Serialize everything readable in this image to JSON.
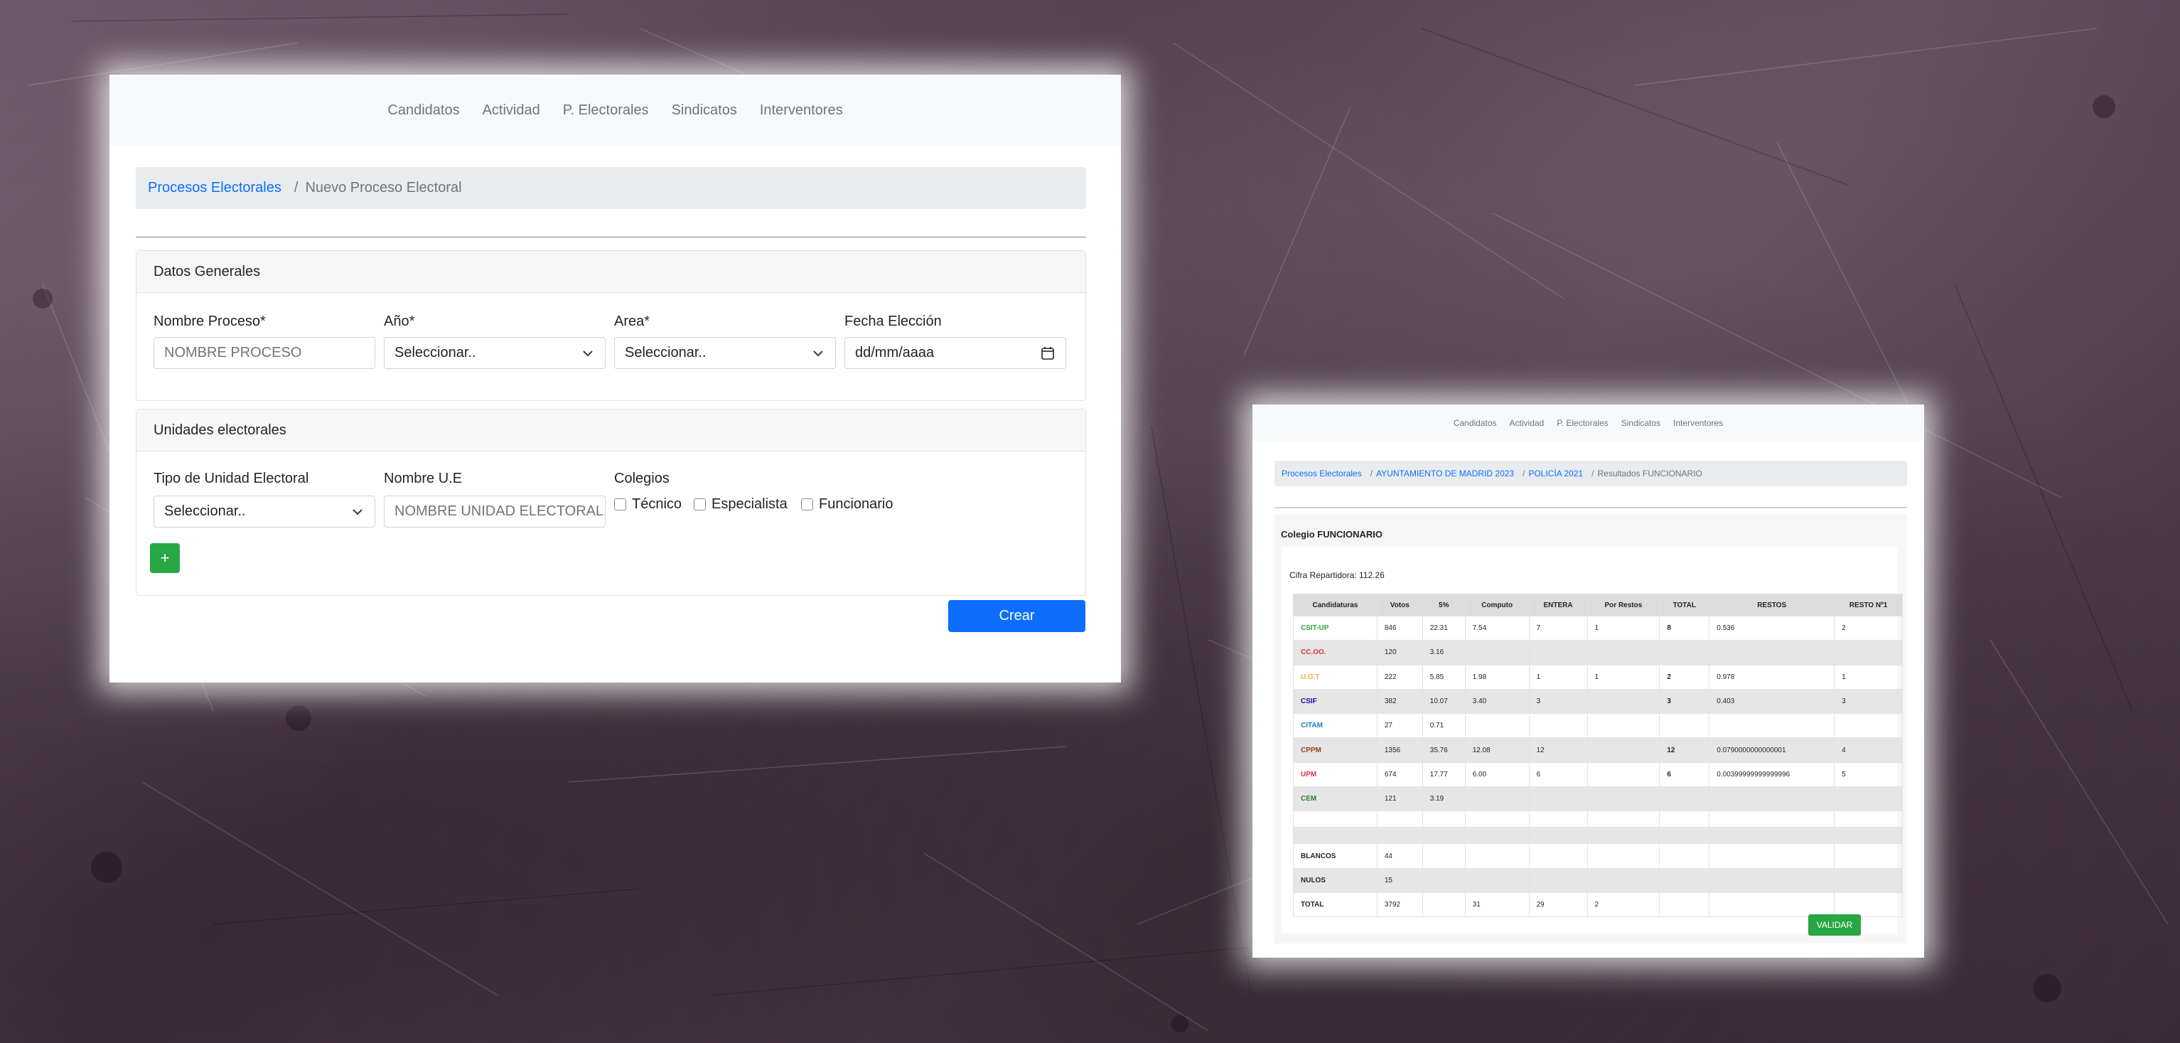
{
  "colors": {
    "primary": "#0d6efd",
    "success": "#28a745",
    "danger": "#dc3545",
    "party_colors": {
      "CSIT-UP": "#28a745",
      "CC.OO.": "#dc3545",
      "U.G.T": "#f0ad4e",
      "CSIF": "#1a0dab",
      "CITAM": "#1f7bc4",
      "CPPM": "#a04020",
      "UPM": "#dc3545",
      "CEM": "#2e7d32",
      "BLANCOS": "#212529",
      "NULOS": "#212529",
      "TOTAL": "#212529"
    }
  },
  "form_window": {
    "nav": [
      "Candidatos",
      "Actividad",
      "P. Electorales",
      "Sindicatos",
      "Interventores"
    ],
    "breadcrumb": {
      "root": "Procesos Electorales",
      "sep": "/",
      "current": "Nuevo Proceso Electoral"
    },
    "datos_generales": {
      "title": "Datos Generales",
      "nombre_label": "Nombre Proceso*",
      "nombre_placeholder": "NOMBRE PROCESO",
      "anio_label": "Año*",
      "anio_value": "Seleccionar..",
      "area_label": "Area*",
      "area_value": "Seleccionar..",
      "fecha_label": "Fecha Elección",
      "fecha_placeholder": "dd/mm/aaaa"
    },
    "unidades": {
      "title": "Unidades electorales",
      "tipo_label": "Tipo de Unidad Electoral",
      "tipo_value": "Seleccionar..",
      "nombre_label": "Nombre U.E",
      "nombre_placeholder": "NOMBRE UNIDAD ELECTORAL",
      "colegios_label": "Colegios",
      "colegios": [
        "Técnico",
        "Especialista",
        "Funcionario"
      ],
      "add_label": "+"
    },
    "crear_label": "Crear"
  },
  "results_window": {
    "nav": [
      "Candidatos",
      "Actividad",
      "P. Electorales",
      "Sindicatos",
      "Interventores"
    ],
    "breadcrumb": [
      "Procesos Electorales",
      "AYUNTAMIENTO DE MADRID 2023",
      "POLICÍA 2021",
      "Resultados FUNCIONARIO"
    ],
    "breadcrumb_sep": "/",
    "title": "Colegio FUNCIONARIO",
    "cifra": "Cifra Repartidora: 112.26",
    "columns": [
      "Candidaturas",
      "Votos",
      "5%",
      "Computo",
      "ENTERA",
      "Por Restos",
      "TOTAL",
      "RESTOS",
      "RESTO Nº1"
    ],
    "rows": [
      [
        "CSIT-UP",
        "846",
        "22.31",
        "7.54",
        "7",
        "1",
        "8",
        "0.536",
        "2"
      ],
      [
        "CC.OO.",
        "120",
        "3.16",
        "",
        "",
        "",
        "",
        "",
        ""
      ],
      [
        "U.G.T",
        "222",
        "5.85",
        "1.98",
        "1",
        "1",
        "2",
        "0.978",
        "1"
      ],
      [
        "CSIF",
        "382",
        "10.07",
        "3.40",
        "3",
        "",
        "3",
        "0.403",
        "3"
      ],
      [
        "CITAM",
        "27",
        "0.71",
        "",
        "",
        "",
        "",
        "",
        ""
      ],
      [
        "CPPM",
        "1356",
        "35.76",
        "12.08",
        "12",
        "",
        "12",
        "0.0790000000000001",
        "4"
      ],
      [
        "UPM",
        "674",
        "17.77",
        "6.00",
        "6",
        "",
        "6",
        "0.00399999999999996",
        "5"
      ],
      [
        "CEM",
        "121",
        "3.19",
        "",
        "",
        "",
        "",
        "",
        ""
      ],
      [
        "",
        "",
        "",
        "",
        "",
        "",
        "",
        "",
        ""
      ],
      [
        "",
        "",
        "",
        "",
        "",
        "",
        "",
        "",
        ""
      ],
      [
        "BLANCOS",
        "44",
        "",
        "",
        "",
        "",
        "",
        "",
        ""
      ],
      [
        "NULOS",
        "15",
        "",
        "",
        "",
        "",
        "",
        "",
        ""
      ],
      [
        "TOTAL",
        "3792",
        "",
        "31",
        "29",
        "2",
        "",
        "",
        ""
      ]
    ],
    "validar_label": "VALIDAR"
  }
}
